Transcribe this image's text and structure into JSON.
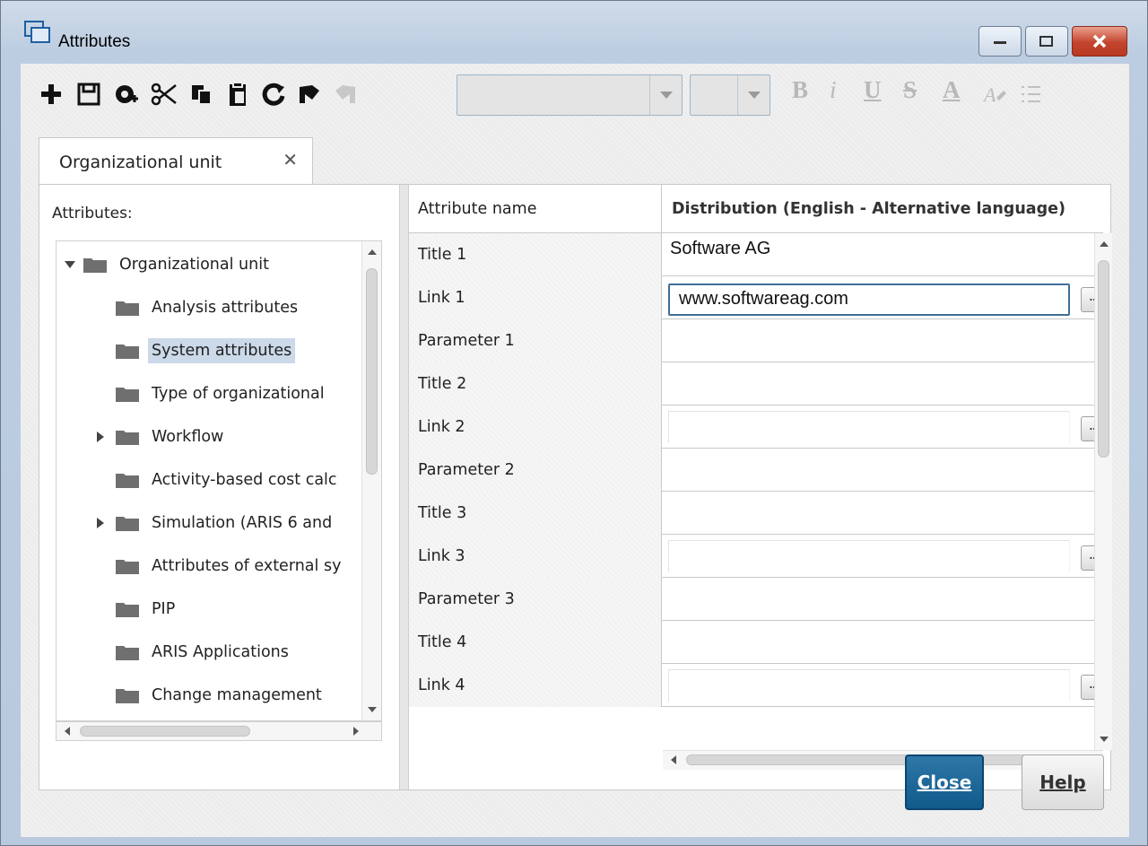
{
  "window": {
    "title": "Attributes",
    "icon": "window-copy-icon"
  },
  "toolbar": {
    "icons": [
      "add-icon",
      "save-icon",
      "insert-object-icon",
      "cut-icon",
      "copy-icon",
      "paste-icon",
      "refresh-icon",
      "undo-icon",
      "redo-icon"
    ],
    "format_buttons": [
      "B",
      "i",
      "U",
      "S",
      "A"
    ]
  },
  "tab": {
    "label": "Organizational unit",
    "close_glyph": "✕"
  },
  "left_panel": {
    "label": "Attributes:",
    "tree": [
      {
        "label": "Organizational unit",
        "level": 0,
        "expander": "expanded"
      },
      {
        "label": "Analysis attributes",
        "level": 1,
        "expander": "none"
      },
      {
        "label": "System attributes",
        "level": 1,
        "expander": "none",
        "selected": true
      },
      {
        "label": "Type of organizational",
        "level": 1,
        "expander": "none"
      },
      {
        "label": "Workflow",
        "level": 1,
        "expander": "collapsed"
      },
      {
        "label": "Activity-based cost calc",
        "level": 1,
        "expander": "none"
      },
      {
        "label": "Simulation (ARIS 6 and",
        "level": 1,
        "expander": "collapsed"
      },
      {
        "label": "Attributes of external sy",
        "level": 1,
        "expander": "none"
      },
      {
        "label": "PIP",
        "level": 1,
        "expander": "none"
      },
      {
        "label": "ARIS Applications",
        "level": 1,
        "expander": "none"
      },
      {
        "label": "Change management",
        "level": 1,
        "expander": "none"
      }
    ]
  },
  "grid": {
    "columns": [
      "Attribute name",
      "Distribution (English - Alternative language)"
    ],
    "rows": [
      {
        "name": "Title 1",
        "value": "Software AG",
        "kind": "text"
      },
      {
        "name": "Link 1",
        "value": "www.softwareag.com",
        "kind": "link-active"
      },
      {
        "name": "Parameter 1",
        "value": "",
        "kind": "text"
      },
      {
        "name": "Title 2",
        "value": "",
        "kind": "text"
      },
      {
        "name": "Link 2",
        "value": "",
        "kind": "link"
      },
      {
        "name": "Parameter 2",
        "value": "",
        "kind": "text"
      },
      {
        "name": "Title 3",
        "value": "",
        "kind": "text"
      },
      {
        "name": "Link 3",
        "value": "",
        "kind": "link"
      },
      {
        "name": "Parameter 3",
        "value": "",
        "kind": "text"
      },
      {
        "name": "Title 4",
        "value": "",
        "kind": "text"
      },
      {
        "name": "Link 4",
        "value": "",
        "kind": "link"
      }
    ],
    "browse_button": "..."
  },
  "buttons": {
    "close": "Close",
    "help": "Help"
  }
}
